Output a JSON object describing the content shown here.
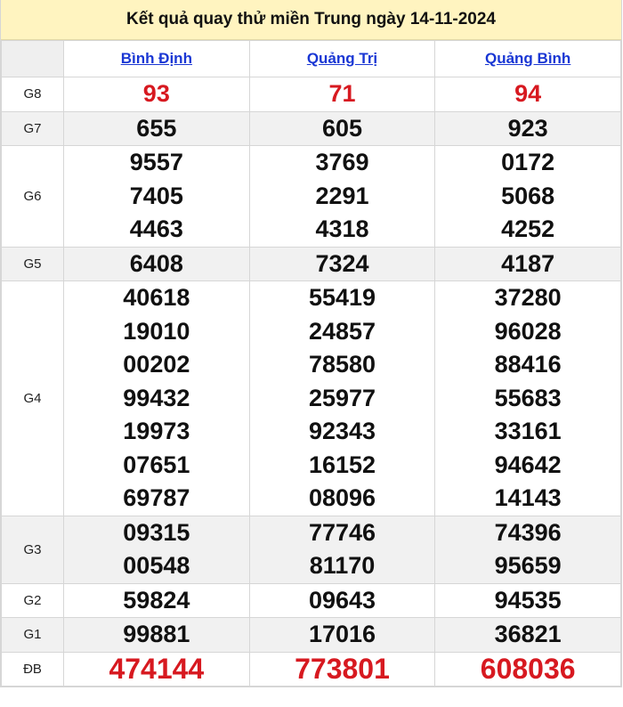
{
  "title": "Kết quả quay thử miền Trung ngày 14-11-2024",
  "provinces": [
    "Bình Định",
    "Quảng Trị",
    "Quảng Bình"
  ],
  "prizes": [
    {
      "label": "G8",
      "values": [
        [
          "93"
        ],
        [
          "71"
        ],
        [
          "94"
        ]
      ]
    },
    {
      "label": "G7",
      "values": [
        [
          "655"
        ],
        [
          "605"
        ],
        [
          "923"
        ]
      ]
    },
    {
      "label": "G6",
      "values": [
        [
          "9557",
          "7405",
          "4463"
        ],
        [
          "3769",
          "2291",
          "4318"
        ],
        [
          "0172",
          "5068",
          "4252"
        ]
      ]
    },
    {
      "label": "G5",
      "values": [
        [
          "6408"
        ],
        [
          "7324"
        ],
        [
          "4187"
        ]
      ]
    },
    {
      "label": "G4",
      "values": [
        [
          "40618",
          "19010",
          "00202",
          "99432",
          "19973",
          "07651",
          "69787"
        ],
        [
          "55419",
          "24857",
          "78580",
          "25977",
          "92343",
          "16152",
          "08096"
        ],
        [
          "37280",
          "96028",
          "88416",
          "55683",
          "33161",
          "94642",
          "14143"
        ]
      ]
    },
    {
      "label": "G3",
      "values": [
        [
          "09315",
          "00548"
        ],
        [
          "77746",
          "81170"
        ],
        [
          "74396",
          "95659"
        ]
      ]
    },
    {
      "label": "G2",
      "values": [
        [
          "59824"
        ],
        [
          "09643"
        ],
        [
          "94535"
        ]
      ]
    },
    {
      "label": "G1",
      "values": [
        [
          "99881"
        ],
        [
          "17016"
        ],
        [
          "36821"
        ]
      ]
    },
    {
      "label": "ĐB",
      "values": [
        [
          "474144"
        ],
        [
          "773801"
        ],
        [
          "608036"
        ]
      ]
    }
  ],
  "colors": {
    "header_bg": "#fff4c0",
    "link": "#1a37d4",
    "special": "#d71920",
    "stripe": "#f1f1f1"
  }
}
